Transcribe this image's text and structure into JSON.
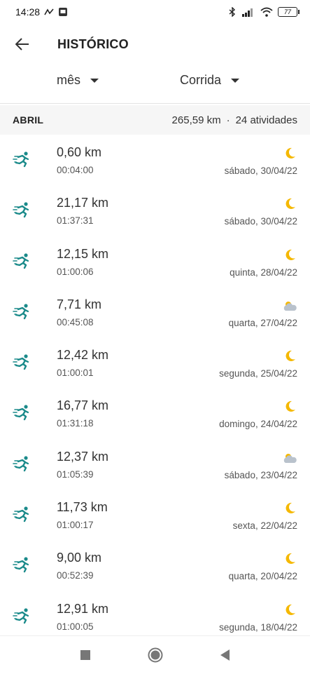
{
  "status_bar": {
    "time": "14:28",
    "battery": "77"
  },
  "header": {
    "title": "HISTÓRICO"
  },
  "filters": {
    "period": "mês",
    "activity_type": "Corrida"
  },
  "summary": {
    "month": "ABRIL",
    "total_distance": "265,59 km",
    "separator": "·",
    "activities": "24 atividades"
  },
  "colors": {
    "accent": "#1a8a8a",
    "moon": "#f5b800",
    "cloud": "#b9c2cc"
  },
  "activities": [
    {
      "distance": "0,60 km",
      "duration": "00:04:00",
      "date": "sábado, 30/04/22",
      "weather": "moon-icon"
    },
    {
      "distance": "21,17 km",
      "duration": "01:37:31",
      "date": "sábado, 30/04/22",
      "weather": "moon-icon"
    },
    {
      "distance": "12,15 km",
      "duration": "01:00:06",
      "date": "quinta, 28/04/22",
      "weather": "moon-icon"
    },
    {
      "distance": "7,71 km",
      "duration": "00:45:08",
      "date": "quarta, 27/04/22",
      "weather": "partly-cloudy-icon"
    },
    {
      "distance": "12,42 km",
      "duration": "01:00:01",
      "date": "segunda, 25/04/22",
      "weather": "moon-icon"
    },
    {
      "distance": "16,77 km",
      "duration": "01:31:18",
      "date": "domingo, 24/04/22",
      "weather": "moon-icon"
    },
    {
      "distance": "12,37 km",
      "duration": "01:05:39",
      "date": "sábado, 23/04/22",
      "weather": "partly-cloudy-icon"
    },
    {
      "distance": "11,73 km",
      "duration": "01:00:17",
      "date": "sexta, 22/04/22",
      "weather": "moon-icon"
    },
    {
      "distance": "9,00 km",
      "duration": "00:52:39",
      "date": "quarta, 20/04/22",
      "weather": "moon-icon"
    },
    {
      "distance": "12,91 km",
      "duration": "01:00:05",
      "date": "segunda, 18/04/22",
      "weather": "moon-icon"
    }
  ]
}
